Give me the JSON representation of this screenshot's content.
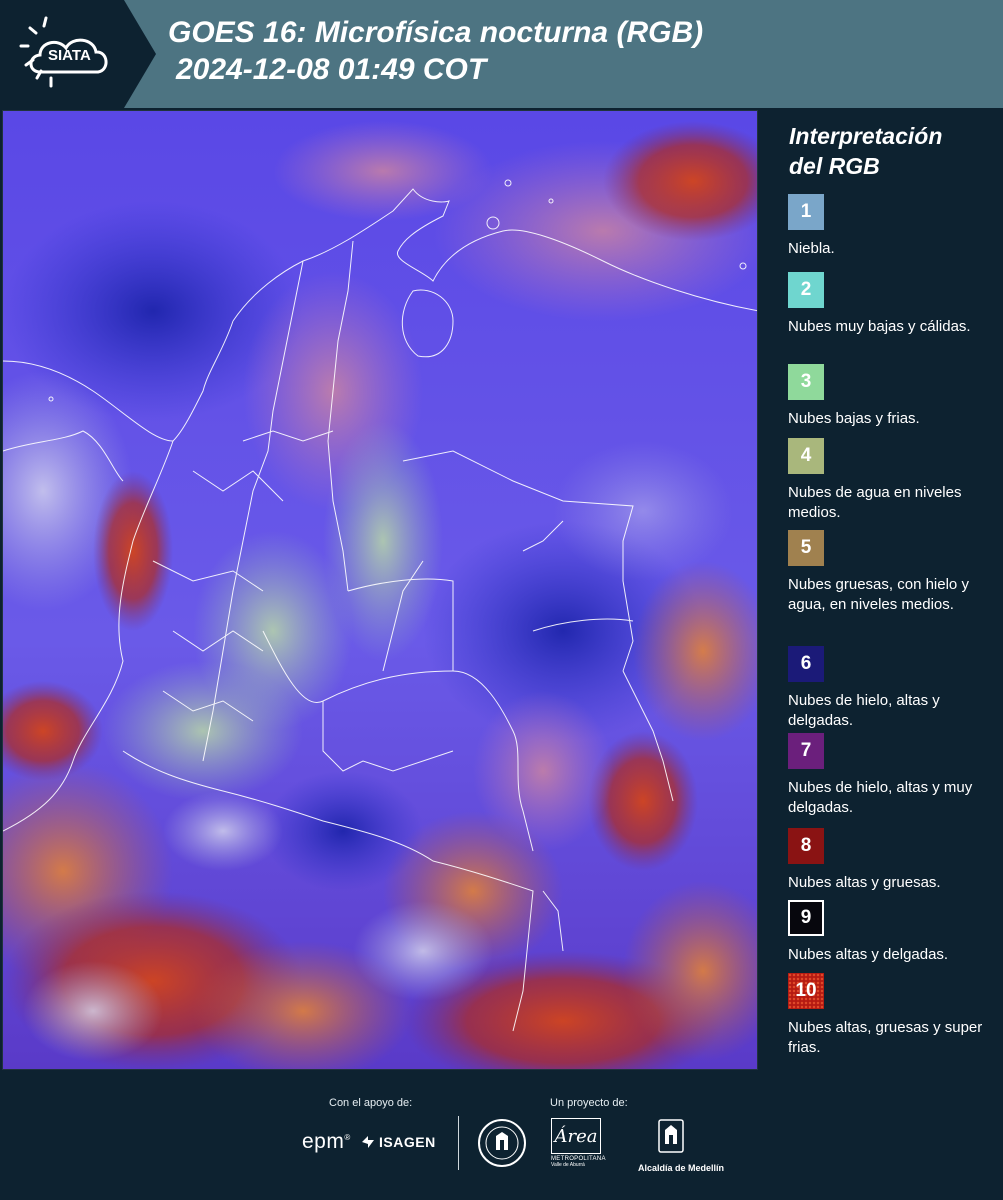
{
  "header": {
    "logo_text": "SIATA",
    "title_line1": "GOES 16: Microfísica nocturna (RGB)",
    "title_line2": "2024-12-08 01:49 COT",
    "background_color": "#4d7482"
  },
  "map": {
    "icon": "satellite-map-image"
  },
  "legend": {
    "title_line1": "Interpretación",
    "title_line2": "del RGB",
    "items": [
      {
        "number": "1",
        "label": "Niebla.",
        "color": "#7aa6c9"
      },
      {
        "number": "2",
        "label": "Nubes muy bajas y cálidas.",
        "color": "#6fd6cf"
      },
      {
        "number": "3",
        "label": "Nubes bajas y frias.",
        "color": "#8fd99b"
      },
      {
        "number": "4",
        "label": "Nubes de agua en niveles medios.",
        "color": "#a9b77c"
      },
      {
        "number": "5",
        "label": "Nubes gruesas, con hielo y agua, en niveles medios.",
        "color": "#a0814f"
      },
      {
        "number": "6",
        "label": "Nubes de hielo, altas y delgadas.",
        "color": "#1b1a78"
      },
      {
        "number": "7",
        "label": "Nubes de hielo, altas y muy delgadas.",
        "color": "#6b1f7c"
      },
      {
        "number": "8",
        "label": "Nubes altas y gruesas.",
        "color": "#8a1313"
      },
      {
        "number": "9",
        "label": "Nubes altas y delgadas.",
        "color": "#07070d"
      },
      {
        "number": "10",
        "label": "Nubes altas, gruesas y super frias.",
        "color": "#b51a12"
      }
    ]
  },
  "footer": {
    "support_label": "Con el apoyo de:",
    "project_label": "Un proyecto de:",
    "epm": "epm",
    "isagen": "ISAGEN",
    "area_script": "Área",
    "area_sub1": "METROPOLITANA",
    "area_sub2": "Valle de Aburrá",
    "medellin": "Alcaldía de Medellín"
  }
}
